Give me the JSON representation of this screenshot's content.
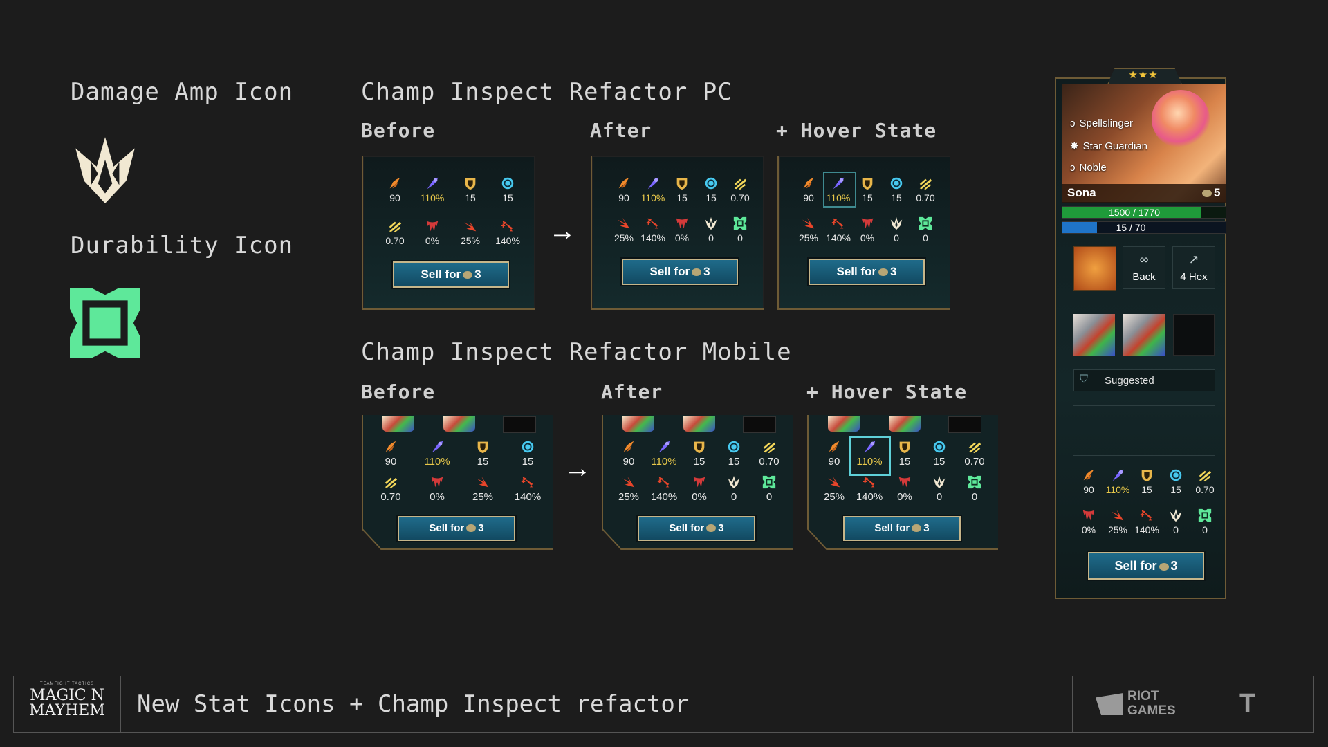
{
  "left": {
    "damage_amp_title": "Damage Amp Icon",
    "durability_title": "Durability Icon"
  },
  "pc": {
    "title": "Champ Inspect Refactor PC",
    "before_label": "Before",
    "after_label": "After",
    "hover_label": "+ Hover State"
  },
  "mobile": {
    "title": "Champ Inspect Refactor Mobile",
    "before_label": "Before",
    "after_label": "After",
    "hover_label": "+ Hover State"
  },
  "stats": {
    "ad": "90",
    "ap": "110%",
    "armor": "15",
    "mr": "15",
    "as": "0.70",
    "omnivamp": "0%",
    "crit_chance": "25%",
    "crit_dmg": "140%",
    "damage_amp": "0",
    "durability": "0"
  },
  "sell": {
    "label": "Sell for",
    "cost": "3"
  },
  "champ": {
    "stars": "★★★",
    "traits": [
      "Spellslinger",
      "Star Guardian",
      "Noble"
    ],
    "name": "Sona",
    "cost": "5",
    "hp": "1500 / 1770",
    "hp_fraction": 0.85,
    "mana": "15 / 70",
    "mana_fraction": 0.21,
    "back_label": "Back",
    "hex_label": "4 Hex",
    "suggested_label": "Suggested"
  },
  "footer": {
    "logo_small": "TEAMFIGHT TACTICS",
    "logo_main": "MAGIC N MAYHEM",
    "title": "New Stat Icons + Champ Inspect refactor",
    "riot_logo": "RIOT GAMES"
  },
  "colors": {
    "bg": "#1c1c1c",
    "damage_amp_icon": "#f1e8d2",
    "durability_icon": "#5ee89a",
    "gold_text": "#e8c84a",
    "hp_green": "#1f9a3a",
    "mana_blue": "#1f74c8"
  },
  "icons": [
    "damage-amp-icon",
    "durability-icon",
    "ad-icon",
    "ap-icon",
    "armor-icon",
    "mr-icon",
    "attack-speed-icon",
    "omnivamp-icon",
    "crit-chance-icon",
    "crit-damage-icon"
  ]
}
